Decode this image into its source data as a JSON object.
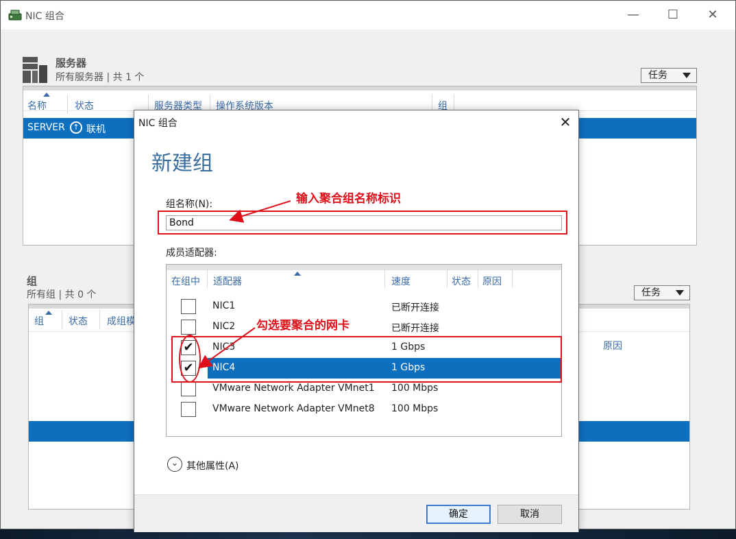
{
  "window": {
    "title": "NIC 组合",
    "minimize": "—",
    "maximize": "☐",
    "close": "✕"
  },
  "servers": {
    "heading": "服务器",
    "subtitle": "所有服务器 | 共 1 个",
    "tasks_label": "任务",
    "columns": [
      "名称",
      "状态",
      "服务器类型",
      "操作系统版本",
      "组"
    ],
    "rows": [
      {
        "name": "SERVER",
        "status_icon": "↑",
        "status": "联机"
      }
    ]
  },
  "groups": {
    "heading": "组",
    "subtitle": "所有组 | 共 0 个",
    "tasks_label": "任务",
    "columns": [
      "组",
      "状态",
      "成组模",
      "原因"
    ]
  },
  "dialog": {
    "title": "NIC 组合",
    "close": "✕",
    "heading": "新建组",
    "team_name_label": "组名称(N):",
    "team_name_value": "Bond",
    "members_label": "成员适配器:",
    "adapter_columns": [
      "在组中",
      "适配器",
      "速度",
      "状态",
      "原因"
    ],
    "adapters": [
      {
        "name": "NIC1",
        "speed": "已断开连接",
        "checked": false
      },
      {
        "name": "NIC2",
        "speed": "已断开连接",
        "checked": false
      },
      {
        "name": "NIC3",
        "speed": "1 Gbps",
        "checked": true
      },
      {
        "name": "NIC4",
        "speed": "1 Gbps",
        "checked": true
      },
      {
        "name": "VMware Network Adapter VMnet1",
        "speed": "100 Mbps",
        "checked": false
      },
      {
        "name": "VMware Network Adapter VMnet8",
        "speed": "100 Mbps",
        "checked": false
      }
    ],
    "more_properties": "其他属性(A)",
    "ok": "确定",
    "cancel": "取消"
  },
  "annotations": {
    "name_hint": "输入聚合组名称标识",
    "select_hint": "勾选要聚合的网卡",
    "color": "#e0101a"
  },
  "colors": {
    "selection": "#0e6fbf",
    "heading_blue": "#3a6e9e"
  }
}
